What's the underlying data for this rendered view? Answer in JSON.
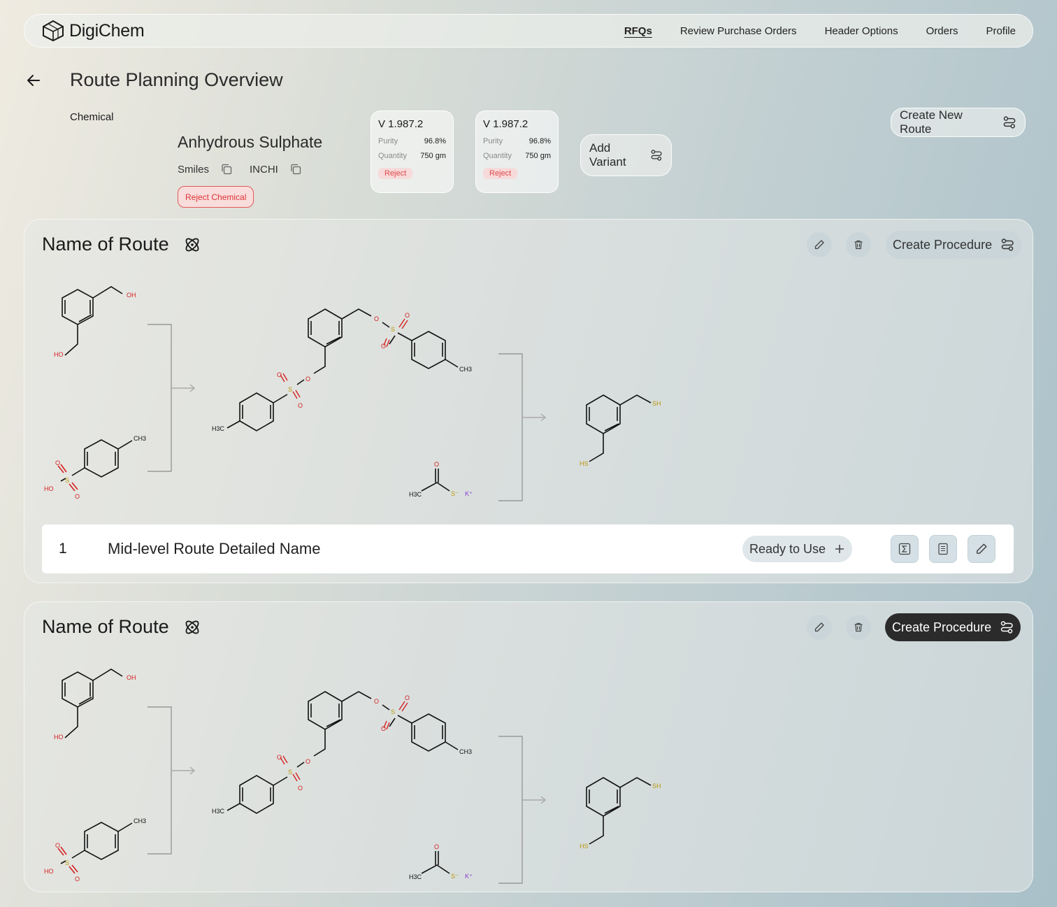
{
  "app": {
    "name": "DigiChem",
    "logo_icon": "hexagon-logo-icon"
  },
  "nav": {
    "links": [
      "RFQs",
      "Review Purchase Orders",
      "Header Options",
      "Orders",
      "Profile"
    ],
    "active": "RFQs"
  },
  "page": {
    "title": "Route Planning Overview",
    "back_icon": "arrow-left-icon"
  },
  "chemical": {
    "label": "Chemical",
    "name": "Anhydrous Sulphate",
    "smiles_label": "Smiles",
    "inchi_label": "INCHI",
    "reject_label": "Reject Chemical"
  },
  "variants": [
    {
      "version": "V 1.987.2",
      "purity_label": "Purity",
      "purity": "96.8%",
      "quantity_label": "Quantity",
      "quantity": "750 gm",
      "reject_label": "Reject"
    },
    {
      "version": "V 1.987.2",
      "purity_label": "Purity",
      "purity": "96.8%",
      "quantity_label": "Quantity",
      "quantity": "750 gm",
      "reject_label": "Reject"
    }
  ],
  "actions": {
    "add_variant": "Add Variant",
    "create_new_route": "Create New Route"
  },
  "routes": [
    {
      "name": "Name of Route",
      "create_procedure": "Create Procedure",
      "create_procedure_style": "light",
      "sub_route": {
        "index": "1",
        "name": "Mid-level Route Detailed Name",
        "status": "Ready to Use"
      }
    },
    {
      "name": "Name of Route",
      "create_procedure": "Create Procedure",
      "create_procedure_style": "dark"
    }
  ],
  "molecule_labels": {
    "oh": "OH",
    "ho": "HO",
    "ch3": "CH3",
    "h3c": "H3C",
    "o": "O",
    "s": "S",
    "sh": "SH",
    "hs": "HS",
    "s_minus": "S⁻",
    "k_plus": "K⁺"
  },
  "colors": {
    "reject": "#e04848",
    "dark_button": "#2b2b2b",
    "oxygen": "#d42020",
    "sulfur": "#b8960a",
    "potassium": "#8a3ccf"
  }
}
